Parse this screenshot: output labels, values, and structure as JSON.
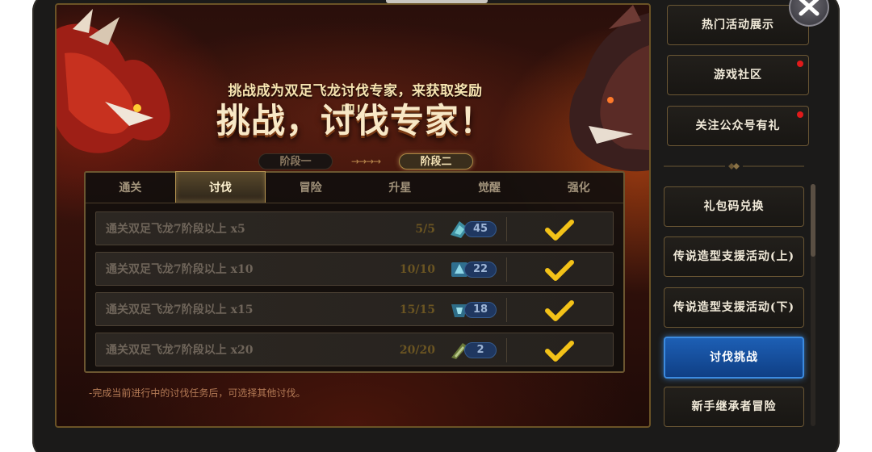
{
  "header": {
    "subtitle": "挑战成为双足飞龙讨伐专家，来获取奖励吧！",
    "title": "挑战，讨伐专家！"
  },
  "stages": {
    "stage_one": "阶段一",
    "stage_two": "阶段二",
    "connector": "→→→→"
  },
  "tabs": [
    {
      "label": "通关"
    },
    {
      "label": "讨伐"
    },
    {
      "label": "冒险"
    },
    {
      "label": "升星"
    },
    {
      "label": "觉醒"
    },
    {
      "label": "强化"
    }
  ],
  "active_tab": "讨伐",
  "tasks": [
    {
      "label": "通关双足飞龙7阶段以上 x5",
      "progress": "5/5",
      "reward_count": "45",
      "completed": true
    },
    {
      "label": "通关双足飞龙7阶段以上 x10",
      "progress": "10/10",
      "reward_count": "22",
      "completed": true
    },
    {
      "label": "通关双足飞龙7阶段以上 x15",
      "progress": "15/15",
      "reward_count": "18",
      "completed": true
    },
    {
      "label": "通关双足飞龙7阶段以上 x20",
      "progress": "20/20",
      "reward_count": "2",
      "completed": true
    }
  ],
  "footnote": "-完成当前进行中的讨伐任务后，可选择其他讨伐。",
  "sidebar": {
    "items": [
      {
        "label": "热门活动展示",
        "notify": false
      },
      {
        "label": "游戏社区",
        "notify": true
      },
      {
        "label": "关注公众号有礼",
        "notify": true
      },
      {
        "label": "礼包码兑换",
        "notify": false
      },
      {
        "label": "传说造型支援活动(上)",
        "notify": false
      },
      {
        "label": "传说造型支援活动(下)",
        "notify": false
      },
      {
        "label": "讨伐挑战",
        "notify": false,
        "active": true
      },
      {
        "label": "新手继承者冒险",
        "notify": false
      }
    ]
  },
  "colors": {
    "accent_gold": "#b59350",
    "active_blue": "#1d5fb4",
    "notify_red": "#e01a1a",
    "check_yellow": "#f3c218"
  },
  "icons": {
    "close": "close-icon",
    "check": "check-icon",
    "reward": "reward-item-icon"
  }
}
